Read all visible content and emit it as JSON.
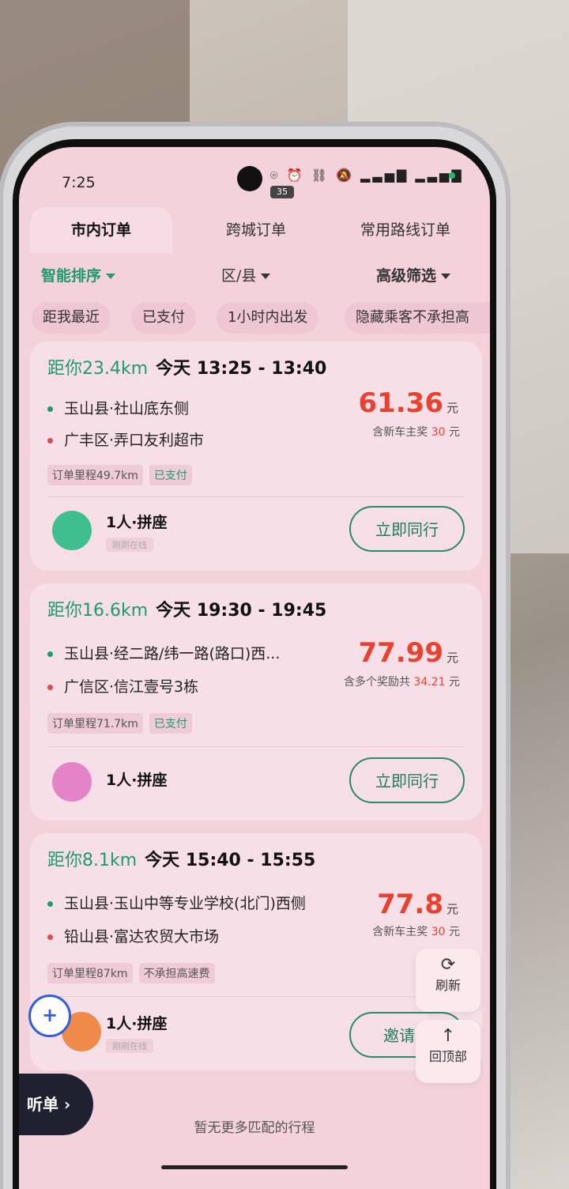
{
  "status": {
    "time": "7:25",
    "icons": "⌾ ⏰ ⛓ 🔕 ▂▃▅▇ ▂▃▅▇",
    "battery": "35"
  },
  "tabs": [
    {
      "label": "市内订单"
    },
    {
      "label": "跨城订单"
    },
    {
      "label": "常用路线订单"
    }
  ],
  "filters": {
    "sort": "智能排序",
    "district": "区/县",
    "advanced": "高级筛选"
  },
  "chips": [
    "距我最近",
    "已支付",
    "1小时内出发",
    "隐藏乘客不承担高"
  ],
  "orders": [
    {
      "distance": "距你23.4km",
      "time": "今天 13:25 - 13:40",
      "from": "玉山县·社山底东侧",
      "to": "广丰区·弄口友利超市",
      "price": "61.36",
      "unit": "元",
      "bonus_text": "含新车主奖",
      "bonus_amount": "30",
      "bonus_unit": "元",
      "tags": [
        "订单里程49.7km",
        "已支付"
      ],
      "seat": "1人·拼座",
      "online": "刚刚在线",
      "action": "立即同行"
    },
    {
      "distance": "距你16.6km",
      "time": "今天 19:30 - 19:45",
      "from": "玉山县·经二路/纬一路(路口)西...",
      "to": "广信区·信江壹号3栋",
      "price": "77.99",
      "unit": "元",
      "bonus_text": "含多个奖励共",
      "bonus_amount": "34.21",
      "bonus_unit": "元",
      "tags": [
        "订单里程71.7km",
        "已支付"
      ],
      "seat": "1人·拼座",
      "online": "",
      "action": "立即同行"
    },
    {
      "distance": "距你8.1km",
      "time": "今天 15:40 - 15:55",
      "from": "玉山县·玉山中等专业学校(北门)西侧",
      "to": "铅山县·富达农贸大市场",
      "price": "77.8",
      "unit": "元",
      "bonus_text": "含新车主奖",
      "bonus_amount": "30",
      "bonus_unit": "元",
      "tags": [
        "订单里程87km",
        "不承担高速费"
      ],
      "seat": "1人·拼座",
      "online": "刚刚在线",
      "action": "邀请同"
    }
  ],
  "float": {
    "refresh": "刷新",
    "top": "回顶部"
  },
  "listen": "听单 ›",
  "no_more": "暂无更多匹配的行程",
  "colors": {
    "accent": "#1e9a6e",
    "price": "#e8412f",
    "background": "#f3d2dc"
  }
}
